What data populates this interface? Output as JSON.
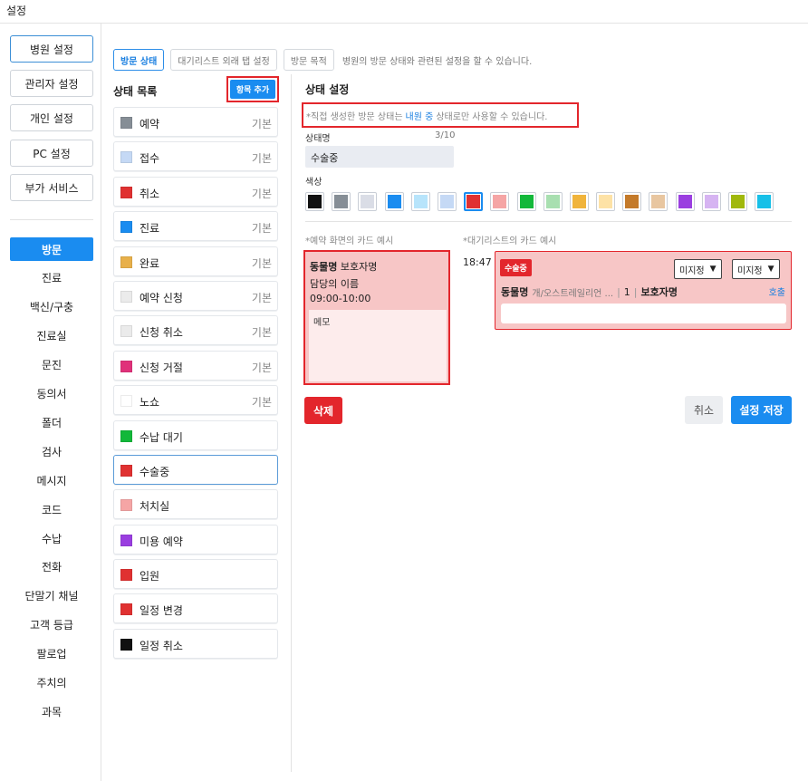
{
  "window": {
    "title": "설정"
  },
  "nav": {
    "buttons": [
      {
        "label": "병원 설정",
        "active": true
      },
      {
        "label": "관리자 설정"
      },
      {
        "label": "개인 설정"
      },
      {
        "label": "PC 설정"
      },
      {
        "label": "부가 서비스"
      }
    ],
    "menu": [
      {
        "label": "방문",
        "active": true
      },
      {
        "label": "진료"
      },
      {
        "label": "백신/구충"
      },
      {
        "label": "진료실"
      },
      {
        "label": "문진"
      },
      {
        "label": "동의서"
      },
      {
        "label": "폴더"
      },
      {
        "label": "검사"
      },
      {
        "label": "메시지"
      },
      {
        "label": "코드"
      },
      {
        "label": "수납"
      },
      {
        "label": "전화"
      },
      {
        "label": "단말기 채널"
      },
      {
        "label": "고객 등급"
      },
      {
        "label": "팔로업"
      },
      {
        "label": "주치의"
      },
      {
        "label": "과목"
      }
    ]
  },
  "tabs": [
    {
      "label": "방문 상태",
      "active": true
    },
    {
      "label": "대기리스트 외래 탭 설정"
    },
    {
      "label": "방문 목적"
    }
  ],
  "tab_description": "병원의 방문 상태와 관련된 설정을 할 수 있습니다.",
  "status_list": {
    "title": "상태 목록",
    "add_label": "항목 추가",
    "items": [
      {
        "label": "예약",
        "color": "#868e96",
        "badge": "기본"
      },
      {
        "label": "접수",
        "color": "#c5d9f5",
        "badge": "기본"
      },
      {
        "label": "취소",
        "color": "#e03131",
        "badge": "기본"
      },
      {
        "label": "진료",
        "color": "#1a8cf0",
        "badge": "기본"
      },
      {
        "label": "완료",
        "color": "#e8b04a",
        "badge": "기본"
      },
      {
        "label": "예약 신청",
        "color": "#ebebeb",
        "badge": "기본"
      },
      {
        "label": "신청 취소",
        "color": "#ebebeb",
        "badge": "기본"
      },
      {
        "label": "신청 거절",
        "color": "#e0317a",
        "badge": "기본"
      },
      {
        "label": "노쇼",
        "color": "#ffffff",
        "badge": "기본"
      },
      {
        "label": "수납 대기",
        "color": "#12b83a",
        "badge": ""
      },
      {
        "label": "수술중",
        "color": "#e03131",
        "badge": "",
        "selected": true
      },
      {
        "label": "처치실",
        "color": "#f5a5a5",
        "badge": ""
      },
      {
        "label": "미용 예약",
        "color": "#9a3ee0",
        "badge": ""
      },
      {
        "label": "입원",
        "color": "#e03131",
        "badge": ""
      },
      {
        "label": "일정 변경",
        "color": "#e03131",
        "badge": ""
      },
      {
        "label": "일정 취소",
        "color": "#111111",
        "badge": ""
      }
    ]
  },
  "settings": {
    "title": "상태 설정",
    "notice_prefix": "*직접 생성한 방문 상태는 ",
    "notice_highlight": "내원 중",
    "notice_suffix": " 상태로만 사용할 수 있습니다.",
    "name_label": "상태명",
    "name_count": "3/10",
    "name_value": "수술중",
    "color_label": "색상",
    "palette": [
      "#111111",
      "#868e96",
      "#dadde6",
      "#1a8cf0",
      "#b7e4fb",
      "#c5d9f5",
      "#e03131",
      "#f5a5a5",
      "#12b83a",
      "#a8dfb0",
      "#f0b43c",
      "#fde2a6",
      "#c47a2a",
      "#e8c6a0",
      "#9a3ee0",
      "#d6b4f2",
      "#a0b80c",
      "#17c0e8"
    ],
    "palette_selected": 6
  },
  "examples": {
    "reservation_label": "*예약 화면의 카드 예시",
    "waitlist_label": "*대기리스트의 카드 예시",
    "reservation_card": {
      "pet": "동물명",
      "owner": "보호자명",
      "doctor": "담당의 이름",
      "time": "09:00-10:00",
      "memo": "메모"
    },
    "waitlist_card": {
      "time": "18:47",
      "badge": "수술중",
      "dropdown1": "미지정",
      "dropdown2": "미지정",
      "pet": "동물명",
      "breed": "개/오스트레일리언 ...",
      "count": "1",
      "owner": "보호자명",
      "call": "호출"
    }
  },
  "actions": {
    "delete": "삭제",
    "cancel": "취소",
    "save": "설정 저장"
  }
}
